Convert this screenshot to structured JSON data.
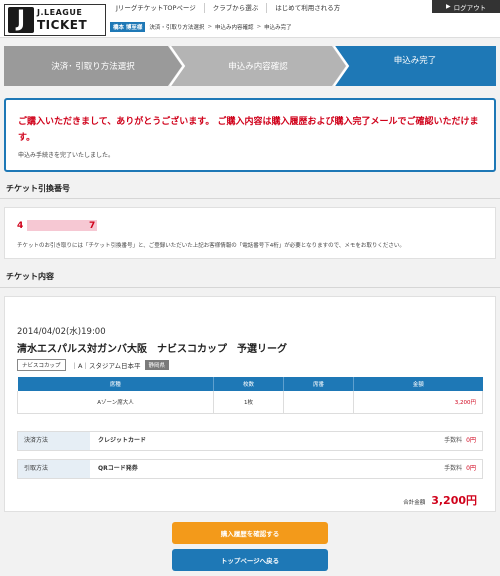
{
  "header": {
    "logo_j": "J",
    "logo_line1": "J.LEAGUE",
    "logo_line2": "TICKET",
    "nav": [
      "JリーグチケットTOPページ",
      "クラブから選ぶ",
      "はじめて利用される方"
    ],
    "login_label": "ログアウト",
    "user_badge": "橋本 博至様",
    "breadcrumb": [
      "決済・引取り方法選択",
      "申込み内容確認",
      "申込み完了"
    ]
  },
  "steps": [
    "決済･ 引取り方法選択",
    "申込み内容確認",
    "申込み完了"
  ],
  "message": {
    "main": "ご購入いただきまして、ありがとうございます。 ご購入内容は購入履歴および購入完了メールでご確認いただけます。",
    "sub": "申込み手続きを完了いたしました。"
  },
  "ticket_exchange": {
    "title": "チケット引換番号",
    "first_digit": "4",
    "last_digit": "7",
    "note": "チケットのお引き取りには「チケット引換番号」と、ご登録いただいた上記お客様情報の「電話番号下4桁」が必要となりますので、メモをお取りください。"
  },
  "ticket_content": {
    "title": "チケット内容",
    "date": "2014/04/02(水)19:00",
    "match": "清水エスパルス対ガンバ大阪　ナビスコカップ　予選リーグ",
    "tag": "ナビスコカップ",
    "venue": "｜A｜スタジアム日本平",
    "prefecture": "静岡県",
    "table_headers": [
      "席種",
      "枚数",
      "席番",
      "金額"
    ],
    "rows": [
      {
        "seat_type": "Aゾーン席大人",
        "count": "1枚",
        "seat_no": "",
        "price": "3,200円"
      }
    ],
    "payment": {
      "label": "決済方法",
      "value": "クレジットカード",
      "fee_label": "手数料",
      "fee": "0円"
    },
    "pickup": {
      "label": "引取方法",
      "value": "QRコード発券",
      "fee_label": "手数料",
      "fee": "0円"
    },
    "total_label": "合計金額",
    "total_value": "3,200円"
  },
  "buttons": {
    "history": "購入履歴を確認する",
    "top": "トップページへ戻る"
  },
  "colors": {
    "accent_blue": "#1e78b6",
    "alert_red": "#d0021b",
    "button_orange": "#f39a1a",
    "step_gray": "#9a9a9a"
  }
}
